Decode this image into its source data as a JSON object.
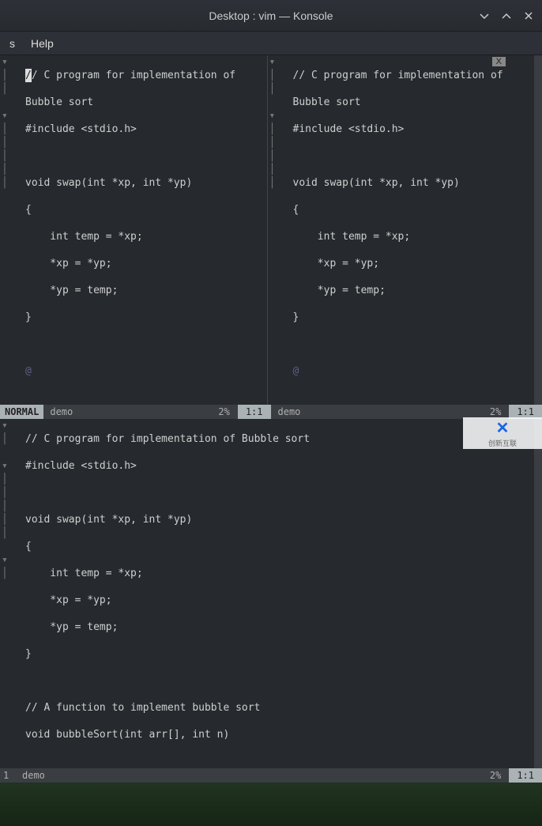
{
  "window": {
    "title": "Desktop : vim — Konsole"
  },
  "menu": {
    "item1": "s",
    "help": "Help"
  },
  "tab": {
    "close": "X"
  },
  "code": {
    "l1": "// C program for implementation of ",
    "l1b": "Bubble sort",
    "l2": "#include <stdio.h>",
    "l3": "",
    "l4": "void swap(int *xp, int *yp)",
    "l5": "{",
    "l6": "    int temp = *xp;",
    "l7": "    *xp = *yp;",
    "l8": "    *yp = temp;",
    "l9": "}",
    "at": "@"
  },
  "code_right": {
    "l1": "// C program for implementation of ",
    "l1b": "Bubble sort",
    "l2": "#include <stdio.h>",
    "l3": "",
    "l4": "void swap(int *xp, int *yp)",
    "l5": "{",
    "l6": "    int temp = *xp;",
    "l7": "    *xp = *yp;",
    "l8": "    *yp = temp;",
    "l9": "}",
    "at": "@"
  },
  "bottom_code": {
    "l1": "// C program for implementation of Bubble sort",
    "l2": "#include <stdio.h>",
    "l3": "",
    "l4": "void swap(int *xp, int *yp)",
    "l5": "{",
    "l6": "    int temp = *xp;",
    "l7": "    *xp = *yp;",
    "l8": "    *yp = temp;",
    "l9": "}",
    "l10": "",
    "l11": "// A function to implement bubble sort",
    "l12": "void bubbleSort(int arr[], int n)"
  },
  "status1": {
    "mode": "NORMAL",
    "file": "demo",
    "pct": "2%",
    "pos": "1:1"
  },
  "status2": {
    "file": "demo",
    "pct": "2%",
    "pos": "1:1"
  },
  "status3": {
    "line": "1",
    "file": "demo",
    "pct": "2%",
    "pos": "1:1"
  },
  "gutter": {
    "m": "▾",
    "p": "│"
  },
  "watermark": {
    "text": "创新互联"
  }
}
